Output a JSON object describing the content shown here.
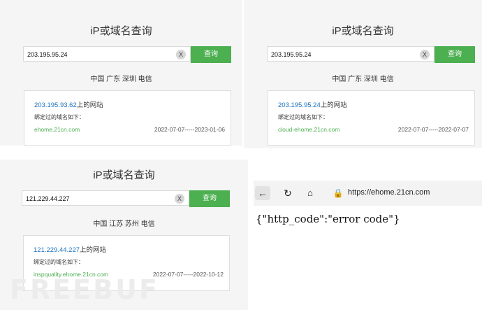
{
  "panels": [
    {
      "title": "iP或域名查询",
      "search_value": "203.195.95.24",
      "clear_label": "X",
      "search_button": "查询",
      "location": "中国 广东 深圳 电信",
      "result": {
        "ip": "203.195.93.62",
        "ip_suffix": "上的网站",
        "bound_label": "绑定过的域名如下：",
        "domain": "ehome.21cn.com",
        "date_range": "2022-07-07-----2023-01-06"
      }
    },
    {
      "title": "iP或域名查询",
      "search_value": "203.195.95.24",
      "clear_label": "X",
      "search_button": "查询",
      "location": "中国 广东 深圳 电信",
      "result": {
        "ip": "203.195.95.24",
        "ip_suffix": "上的网站",
        "bound_label": "绑定过的域名如下：",
        "domain": "cloud-ehome.21cn.com",
        "date_range": "2022-07-07-----2022-07-07"
      }
    },
    {
      "title": "iP或域名查询",
      "search_value": "121.229.44.227",
      "clear_label": "X",
      "search_button": "查询",
      "location": "中国 江苏 苏州 电信",
      "result": {
        "ip": "121.229.44.227",
        "ip_suffix": "上的网站",
        "bound_label": "绑定过的域名如下：",
        "domain": "inspquality.ehome.21cn.com",
        "date_range": "2022-07-07-----2022-10-12"
      }
    }
  ],
  "browser": {
    "icons": [
      "back-arrow-icon",
      "reload-icon",
      "home-icon",
      "lock-icon"
    ],
    "url": "https://ehome.21cn.com",
    "body_text": "{\"http_code\":\"error code\"}"
  },
  "watermark": "FREEBUF"
}
